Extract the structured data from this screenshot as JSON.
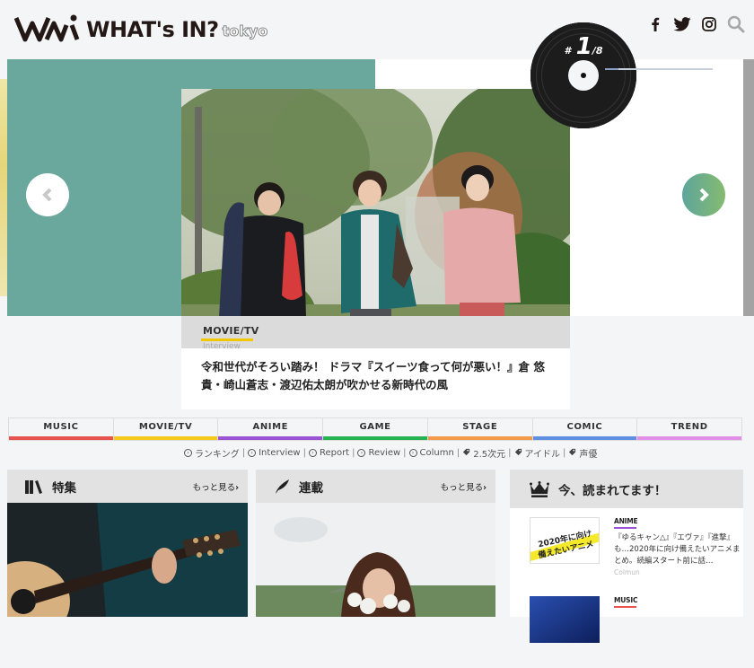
{
  "header": {
    "logo_text": "WHAT's IN?",
    "logo_sub": "tokyo",
    "social": [
      {
        "icon": "facebook-icon",
        "label": "f"
      },
      {
        "icon": "twitter-icon",
        "label": ""
      },
      {
        "icon": "instagram-icon",
        "label": ""
      },
      {
        "icon": "search-icon",
        "label": ""
      }
    ]
  },
  "slider": {
    "current": "1",
    "total": "8",
    "hash": "#",
    "progress_fraction": 0.125,
    "prev_icon": "chevron-left-icon",
    "next_icon": "chevron-right-icon",
    "slide": {
      "category": "MOVIE/TV",
      "category_color": "#f3c700",
      "subcategory": "Interview",
      "title": "令和世代がそろい踏み！ ドラマ『スイーツ食って何が悪い！』倉 悠貴・崎山蒼志・渡辺佑太朗が吹かせる新時代の風"
    }
  },
  "categories": [
    {
      "label": "MUSIC",
      "color": "#e8534f"
    },
    {
      "label": "MOVIE/TV",
      "color": "#f5c91a"
    },
    {
      "label": "ANIME",
      "color": "#9a55d6"
    },
    {
      "label": "GAME",
      "color": "#27b354"
    },
    {
      "label": "STAGE",
      "color": "#f2994a"
    },
    {
      "label": "COMIC",
      "color": "#5f8fe0"
    },
    {
      "label": "TREND",
      "color": "#e190e8"
    }
  ],
  "subnav": [
    {
      "label": "ランキング",
      "icon": "circle-arrow-icon"
    },
    {
      "label": "Interview",
      "icon": "circle-arrow-icon"
    },
    {
      "label": "Report",
      "icon": "circle-arrow-icon"
    },
    {
      "label": "Review",
      "icon": "circle-arrow-icon"
    },
    {
      "label": "Column",
      "icon": "circle-arrow-icon"
    },
    {
      "label": "2.5次元",
      "icon": "tag-icon"
    },
    {
      "label": "アイドル",
      "icon": "tag-icon"
    },
    {
      "label": "声優",
      "icon": "tag-icon"
    }
  ],
  "panels": {
    "feature": {
      "title": "特集",
      "more": "もっと見る",
      "icon": "books-icon"
    },
    "series": {
      "title": "連載",
      "more": "もっと見る",
      "icon": "feather-icon"
    }
  },
  "ranking": {
    "title": "今、読まれてます！",
    "icon": "crown-icon",
    "items": [
      {
        "category": "ANIME",
        "color": "#9a55d6",
        "text": "『ゆるキャン△』『エヴァ』『進撃』も…2020年に向け備えたいアニメまとめ。続編スタート前に話…",
        "sub": "Colmun",
        "thumb_text_1": "2020年に向け",
        "thumb_text_2": "備えたいアニメ"
      },
      {
        "category": "MUSIC",
        "color": "#e8534f",
        "text": "",
        "sub": ""
      }
    ]
  }
}
